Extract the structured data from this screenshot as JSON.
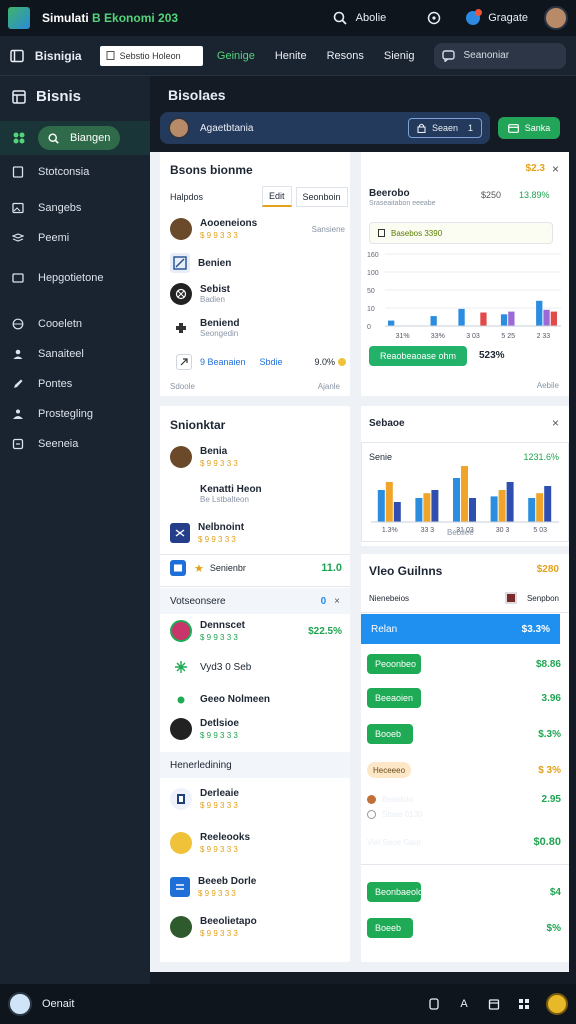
{
  "titlebar": {
    "title_main": "Simulati",
    "title_accent": "B Ekonomi",
    "title_tail": "203",
    "search_label": "Abolie",
    "account_label": "Gragate"
  },
  "menubar": {
    "brand": "Bisnigia",
    "url_placeholder": "Sebstio Holeon",
    "links": [
      "Geinige",
      "Henite",
      "Resons",
      "Sienig"
    ],
    "search_label": "Seanoniar"
  },
  "sidebar": {
    "heading": "Bisnis",
    "active_item": "Biangen",
    "items": [
      "Stotconsia",
      "Sangebs",
      "Peemi",
      "Hepgotietone",
      "Cooeletn",
      "Sanaiteel",
      "Pontes",
      "Prostegling",
      "Seeneia"
    ]
  },
  "header": {
    "title": "Bisolaes",
    "banner_text": "Agaetbtania",
    "chip_label": "Seaen",
    "chip_count": "1",
    "action_label": "Sanka"
  },
  "card_list": {
    "title": "Bsons bionme",
    "filter_label": "Halpdos",
    "tabs": [
      "Edit",
      "Seonboin"
    ],
    "items": [
      {
        "name": "Aooeneions",
        "sub": "$ 9 9 3 3 3",
        "meta": "Sansiene"
      },
      {
        "name": "Benien",
        "sub": ""
      },
      {
        "name": "Sebist",
        "sub": "Badien"
      },
      {
        "name": "Beniend",
        "sub": "Seongedin"
      }
    ],
    "footer_link_a": "9 Beanaien",
    "footer_link_b": "Sbdie",
    "footer_pct": "9.0%",
    "bottom_left": "Sdoole",
    "bottom_right": "Ajanle"
  },
  "card_chart1": {
    "header_value": "$2.3",
    "close": "×",
    "label": "Beerobo",
    "sublabel": "Sraseaitabon eeeabe",
    "value_a": "$250",
    "value_b": "13.89%",
    "input_text": "Basebos 3390",
    "button_label": "Reaobeaoase ohm",
    "button_value": "523%",
    "footer_right": "Aebile"
  },
  "chart_data": [
    {
      "type": "bar",
      "categories": [
        "31%",
        "33%",
        "3 03",
        "5 25",
        "2 33"
      ],
      "series": [
        {
          "values": [
            12,
            0,
            38,
            0,
            0
          ]
        },
        {
          "values": [
            0,
            22,
            0,
            26,
            56
          ]
        },
        {
          "values": [
            0,
            0,
            0,
            32,
            36
          ]
        },
        {
          "values": [
            0,
            0,
            30,
            0,
            32
          ]
        }
      ],
      "yticks": [
        "0",
        "10",
        "50",
        "100",
        "160"
      ],
      "ylim": [
        0,
        160
      ]
    },
    {
      "type": "bar",
      "categories": [
        "1.3%",
        "33 3",
        "31 03",
        "30 3",
        "5 03"
      ],
      "series": [
        {
          "values": [
            40,
            30,
            55,
            32,
            30
          ]
        },
        {
          "values": [
            50,
            36,
            70,
            40,
            36
          ]
        },
        {
          "values": [
            25,
            40,
            30,
            50,
            45
          ]
        }
      ]
    }
  ],
  "card_people": {
    "title": "Snionktar",
    "items": [
      {
        "name": "Benia",
        "sub": "$ 9 9 3 3 3"
      },
      {
        "name": "Kenatti Heon",
        "sub": "Be Lstbalteon"
      },
      {
        "name": "Nelbnoint",
        "sub": "$ 9 9 3 3 3"
      }
    ],
    "row_label": "Senienbr",
    "row_value": "11.0",
    "section2": "Votseonsere",
    "badge": "0",
    "items2": [
      {
        "name": "Dennscet",
        "sub": "$ 9 9 3 3 3",
        "value": "$22.5%"
      },
      {
        "name": "Vyd3 0 Seb",
        "sub": ""
      },
      {
        "name": "Geeo Nolmeen",
        "sub": ""
      },
      {
        "name": "Detlsioe",
        "sub": "$ 9 9 3 3 3"
      }
    ],
    "section3": "Henerledining",
    "items3": [
      {
        "name": "Derleaie",
        "sub": "$ 9 9 3 3 3"
      },
      {
        "name": "Reeleooks",
        "sub": "$ 9 9 3 3 3"
      },
      {
        "name": "Beeeb Dorle",
        "sub": "$ 9 9 3 3 3"
      },
      {
        "name": "Beeolietapo",
        "sub": "$ 9 9 3 3 3"
      }
    ]
  },
  "card_chart2": {
    "title": "Sebaoe",
    "close": "×",
    "label": "Senie",
    "value": "1231.6%",
    "footer": "Bebilee"
  },
  "card_values": {
    "title": "Vleo Guilnns",
    "header_value": "$280",
    "sub_label": "Nienebeios",
    "sub_right": "Senpbon",
    "blue_label": "Relan",
    "blue_value": "$3.3%",
    "rows": [
      {
        "label": "Peoonbeo",
        "value": "$8.86"
      },
      {
        "label": "Beeaoien",
        "value": "3.96"
      },
      {
        "label": "Booeb",
        "value": "$.3%"
      }
    ],
    "tag": "Heceeeo",
    "tag_value": "$ 3%",
    "line_a": "Beaolcio",
    "line_a_value": "2.95",
    "line_b": "Sbaie 0130",
    "line_c": "Viel Seoe Gaor",
    "line_c_value": "$0.80",
    "bottom_rows": [
      {
        "label": "Beonbaeolo",
        "value": "$4"
      },
      {
        "label": "Boeeb",
        "value": "$%"
      }
    ]
  },
  "bottombar": {
    "label": "Oenait"
  },
  "colors": {
    "accent_green": "#22a558",
    "accent_blue": "#1f8ff0",
    "accent_orange": "#e2a21a",
    "bar_blue": "#2a8de0",
    "bar_orange": "#f0a42a",
    "bar_purple": "#9a6ad6",
    "bar_red": "#e24a4a",
    "bar_teal": "#2cc0c0"
  }
}
